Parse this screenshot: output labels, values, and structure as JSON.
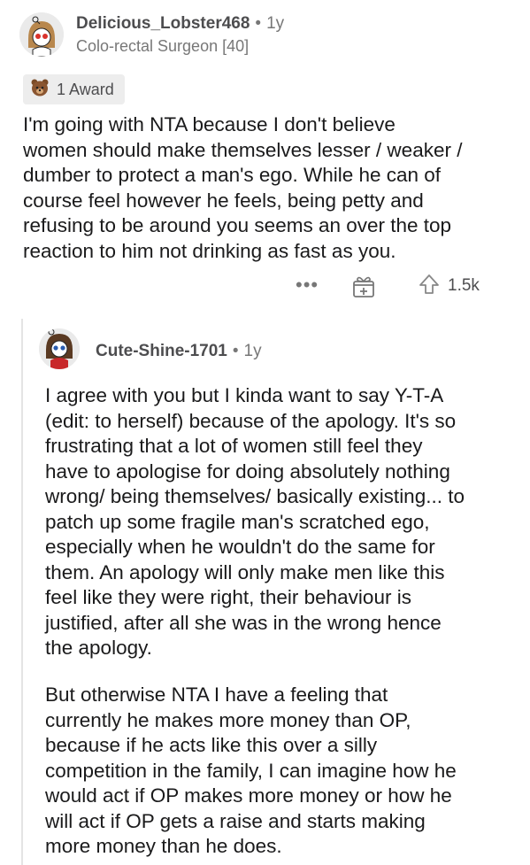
{
  "comment": {
    "username": "Delicious_Lobster468",
    "separator": "•",
    "age": "1y",
    "flair": "Colo-rectal Surgeon [40]",
    "award_label": "1 Award",
    "body": "I'm going with NTA because I don't believe\nwomen should make themselves lesser / weaker /\ndumber to protect a man's ego. While he can of\ncourse feel however he feels, being petty and\nrefusing to be around you seems an over the top\nreaction to him not drinking as fast as you.",
    "actions": {
      "more_label": "•••",
      "upvote_count": "1.5k"
    }
  },
  "reply": {
    "username": "Cute-Shine-1701",
    "separator": "•",
    "age": "1y",
    "paragraph_1": "I agree with you but I kinda want to say Y-T-A\n(edit: to herself) because of the apology. It's so\nfrustrating that a lot of women still feel they\nhave to apologise for doing absolutely nothing\nwrong/ being themselves/ basically existing... to\npatch up some fragile man's scratched ego,\nespecially when he wouldn't do the same for\nthem. An apology will only make men like this\nfeel like they were right, their behaviour is\njustified, after all she was in the wrong hence\nthe apology.",
    "paragraph_2": "But otherwise NTA I have a feeling that\ncurrently he makes more money than OP,\nbecause if he acts like this over a silly\ncompetition in the family, I can imagine how he\nwould act if OP makes more money or how he\nwill act if OP gets a raise and starts making\nmore money than he does."
  },
  "icons": {
    "avatar_1": "snoo-avatar-icon",
    "avatar_2": "snoo-avatar-icon",
    "award": "bear-award-icon",
    "more": "more-dots-icon",
    "gift": "gift-icon",
    "upvote": "upvote-arrow-icon"
  },
  "colors": {
    "text": "#1a1a1b",
    "meta": "#777777",
    "award_bg": "#ededed"
  }
}
